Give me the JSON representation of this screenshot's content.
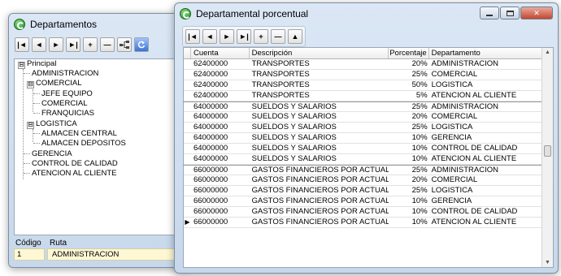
{
  "left_window": {
    "title": "Departamentos",
    "toolbar": [
      "|◄",
      "◄",
      "►",
      "►|",
      "+",
      "—",
      "tree",
      "refresh"
    ],
    "tree": [
      {
        "label": "Principal",
        "level": 0,
        "expander": "⊟"
      },
      {
        "label": "ADMINISTRACION",
        "level": 1
      },
      {
        "label": "COMERCIAL",
        "level": 1,
        "expander": "⊟"
      },
      {
        "label": "JEFE EQUIPO",
        "level": 2
      },
      {
        "label": "COMERCIAL",
        "level": 2
      },
      {
        "label": "FRANQUICIAS",
        "level": 2
      },
      {
        "label": "LOGISTICA",
        "level": 1,
        "expander": "⊟"
      },
      {
        "label": "ALMACEN CENTRAL",
        "level": 2
      },
      {
        "label": "ALMACEN DEPOSITOS",
        "level": 2
      },
      {
        "label": "GERENCIA",
        "level": 1
      },
      {
        "label": "CONTROL DE CALIDAD",
        "level": 1
      },
      {
        "label": "ATENCION AL CLIENTE",
        "level": 1
      }
    ],
    "codigo_label": "Código",
    "ruta_label": "Ruta",
    "codigo_value": "1",
    "ruta_value": "ADMINISTRACION"
  },
  "right_window": {
    "title": "Departamental porcentual",
    "toolbar": [
      "|◄",
      "◄",
      "►",
      "►|",
      "+",
      "—",
      "▲"
    ],
    "columns": [
      "Cuenta",
      "Descripción",
      "Porcentaje",
      "Departamento"
    ],
    "rows": [
      [
        "62400000",
        "TRANSPORTES",
        "20%",
        "ADMINISTRACION"
      ],
      [
        "62400000",
        "TRANSPORTES",
        "25%",
        "COMERCIAL"
      ],
      [
        "62400000",
        "TRANSPORTES",
        "50%",
        "LOGISTICA"
      ],
      [
        "62400000",
        "TRANSPORTES",
        "5%",
        "ATENCION AL CLIENTE"
      ],
      [
        "64000000",
        "SUELDOS Y SALARIOS",
        "25%",
        "ADMINISTRACION"
      ],
      [
        "64000000",
        "SUELDOS Y SALARIOS",
        "20%",
        "COMERCIAL"
      ],
      [
        "64000000",
        "SUELDOS Y SALARIOS",
        "25%",
        "LOGISTICA"
      ],
      [
        "64000000",
        "SUELDOS Y SALARIOS",
        "10%",
        "GERENCIA"
      ],
      [
        "64000000",
        "SUELDOS Y SALARIOS",
        "10%",
        "CONTROL DE CALIDAD"
      ],
      [
        "64000000",
        "SUELDOS Y SALARIOS",
        "10%",
        "ATENCION AL CLIENTE"
      ],
      [
        "66000000",
        "GASTOS FINANCIEROS POR ACTUALI",
        "25%",
        "ADMINISTRACION"
      ],
      [
        "66000000",
        "GASTOS FINANCIEROS POR ACTUALI",
        "20%",
        "COMERCIAL"
      ],
      [
        "66000000",
        "GASTOS FINANCIEROS POR ACTUALI",
        "25%",
        "LOGISTICA"
      ],
      [
        "66000000",
        "GASTOS FINANCIEROS POR ACTUALI",
        "10%",
        "GERENCIA"
      ],
      [
        "66000000",
        "GASTOS FINANCIEROS POR ACTUALI",
        "10%",
        "CONTROL DE CALIDAD"
      ],
      [
        "66000000",
        "GASTOS FINANCIEROS POR ACTUALI",
        "10%",
        "ATENCION AL CLIENTE"
      ]
    ],
    "current_row_index": 15,
    "current_row_marker": "▶"
  }
}
